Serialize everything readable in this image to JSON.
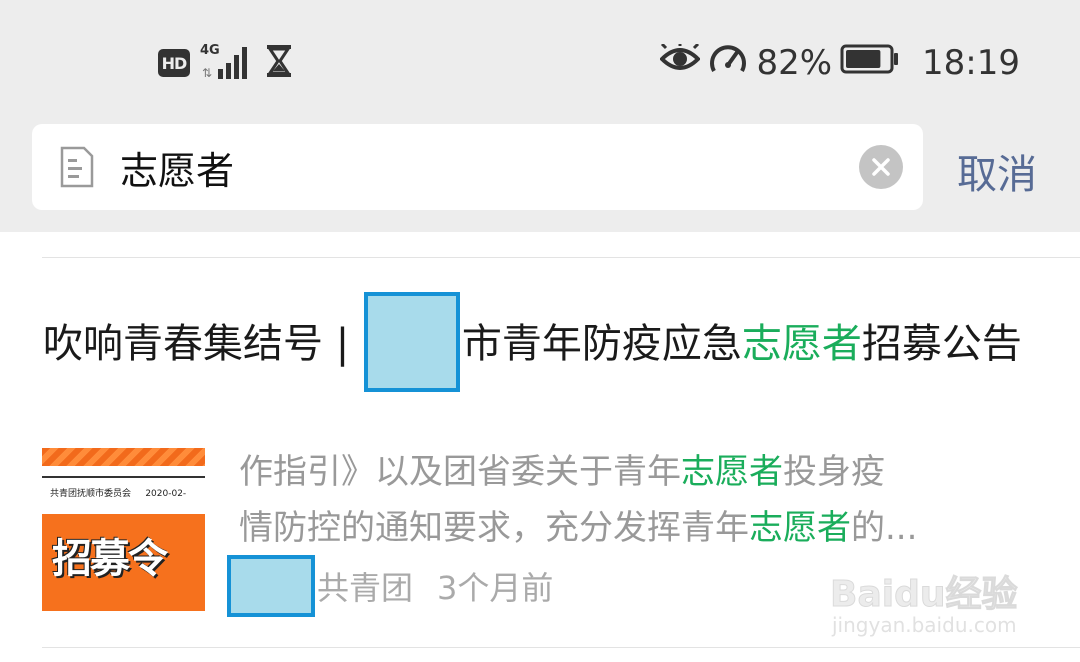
{
  "status_bar": {
    "hd_label": "HD",
    "network_label": "4G",
    "battery_percent": "82%",
    "battery_level": 0.82,
    "time": "18:19"
  },
  "search": {
    "query": "志愿者",
    "cancel_label": "取消"
  },
  "result": {
    "title_pre": "吹响青春集结号 | ",
    "title_mid": "市青年防疫应急",
    "title_hl": "志愿者",
    "title_post": "招募公告",
    "thumbnail": {
      "org_text": "共青团抚顺市委员会",
      "date_text": "2020-02-",
      "headline": "招募令"
    },
    "snippet_line1_a": "作指引》以及团省委关于青年",
    "snippet_line1_hl": "志愿者",
    "snippet_line1_b": "投身疫",
    "snippet_line2_a": "情防控的通知要求，充分发挥青年",
    "snippet_line2_hl": "志愿者",
    "snippet_line2_b": "的...",
    "source": "共青团",
    "time_ago": "3个月前"
  },
  "watermark": {
    "brand": "Baidu经验",
    "url": "jingyan.baidu.com"
  },
  "colors": {
    "highlight": "#1aad5b",
    "cancel": "#576b95",
    "status_bg": "#ededed",
    "redact_fill": "#a8dbeb",
    "redact_border": "#1592d6"
  }
}
